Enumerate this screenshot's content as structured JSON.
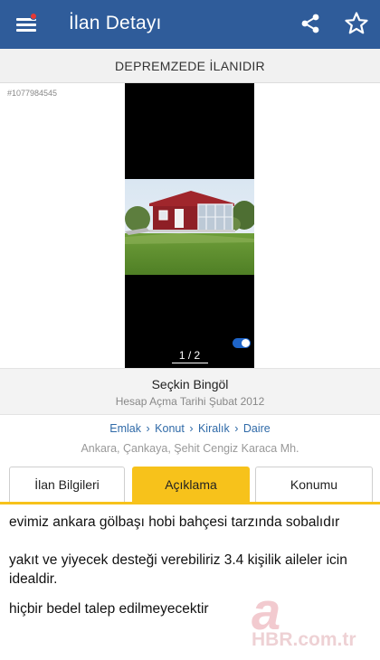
{
  "header": {
    "title": "İlan Detayı",
    "bg_color": "#2f5c9a",
    "menu_icon": "hamburger-menu-icon",
    "share_icon": "share-icon",
    "favorite_icon": "star-outline-icon"
  },
  "banner": {
    "text": "DEPREMZEDE İLANIDIR"
  },
  "listing": {
    "id": "#1077984545"
  },
  "gallery": {
    "pager": "1 / 2"
  },
  "owner": {
    "name": "Seçkin Bingöl",
    "since": "Hesap Açma Tarihi  Şubat 2012"
  },
  "breadcrumb": {
    "items": [
      "Emlak",
      "Konut",
      "Kiralık",
      "Daire"
    ],
    "separator": "›"
  },
  "location": "Ankara, Çankaya, Şehit Cengiz Karaca Mh.",
  "tabs": {
    "items": [
      {
        "label": "İlan Bilgileri"
      },
      {
        "label": "Açıklama"
      },
      {
        "label": "Konumu"
      }
    ],
    "active": 1,
    "active_color": "#f7c21b"
  },
  "description": {
    "lines": [
      "evimiz ankara gölbaşı hobi bahçesi tarzında sobalıdır",
      "yakıt ve yiyecek desteği verebiliriz 3.4 kişilik aileler icin idealdir.",
      "hiçbir bedel talep edilmeyecektir"
    ]
  },
  "watermark": {
    "logo_letter": "a",
    "text": "HBR.com.tr"
  }
}
